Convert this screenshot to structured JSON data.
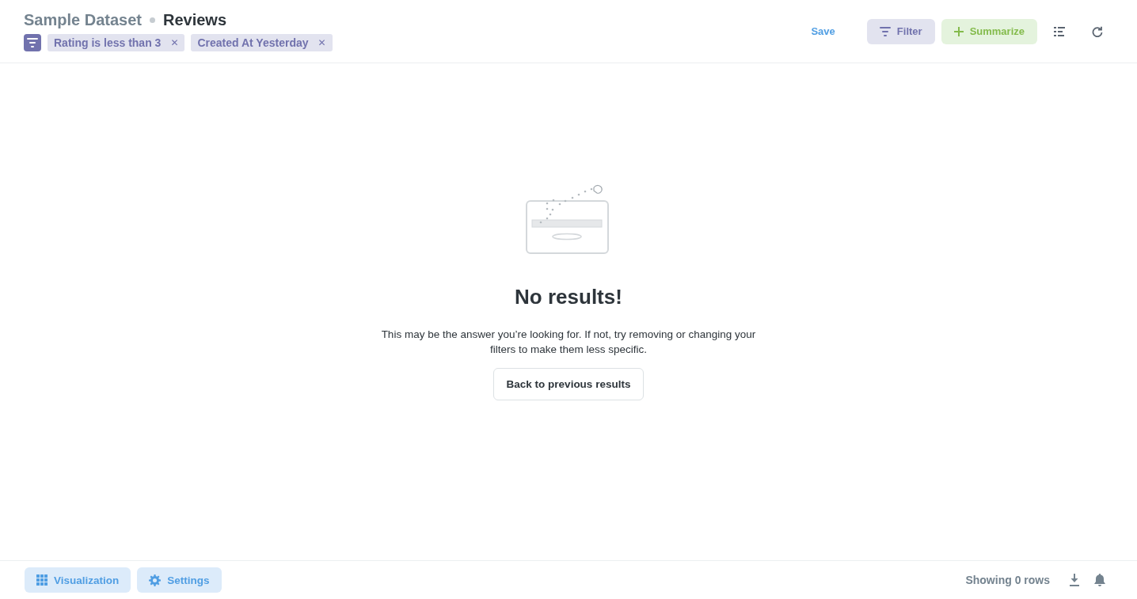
{
  "header": {
    "database": "Sample Dataset",
    "table": "Reviews",
    "filters": [
      {
        "label": "Rating is less than 3",
        "remove": "✕"
      },
      {
        "label": "Created At Yesterday",
        "remove": "✕"
      }
    ],
    "actions": [
      {
        "kind": "link",
        "label": "Save"
      },
      {
        "kind": "filter",
        "label": "Filter"
      },
      {
        "kind": "summarize",
        "label": "Summarize"
      },
      {
        "kind": "list"
      },
      {
        "kind": "refresh"
      }
    ]
  },
  "empty_state": {
    "title": "No results!",
    "message": "This may be the answer you’re looking for. If not, try removing or changing your filters to make them less specific.",
    "button": "Back to previous results"
  },
  "footer": {
    "buttons": [
      {
        "kind": "visualization",
        "label": "Visualization"
      },
      {
        "kind": "settings",
        "label": "Settings"
      }
    ],
    "row_count": "Showing 0 rows"
  }
}
